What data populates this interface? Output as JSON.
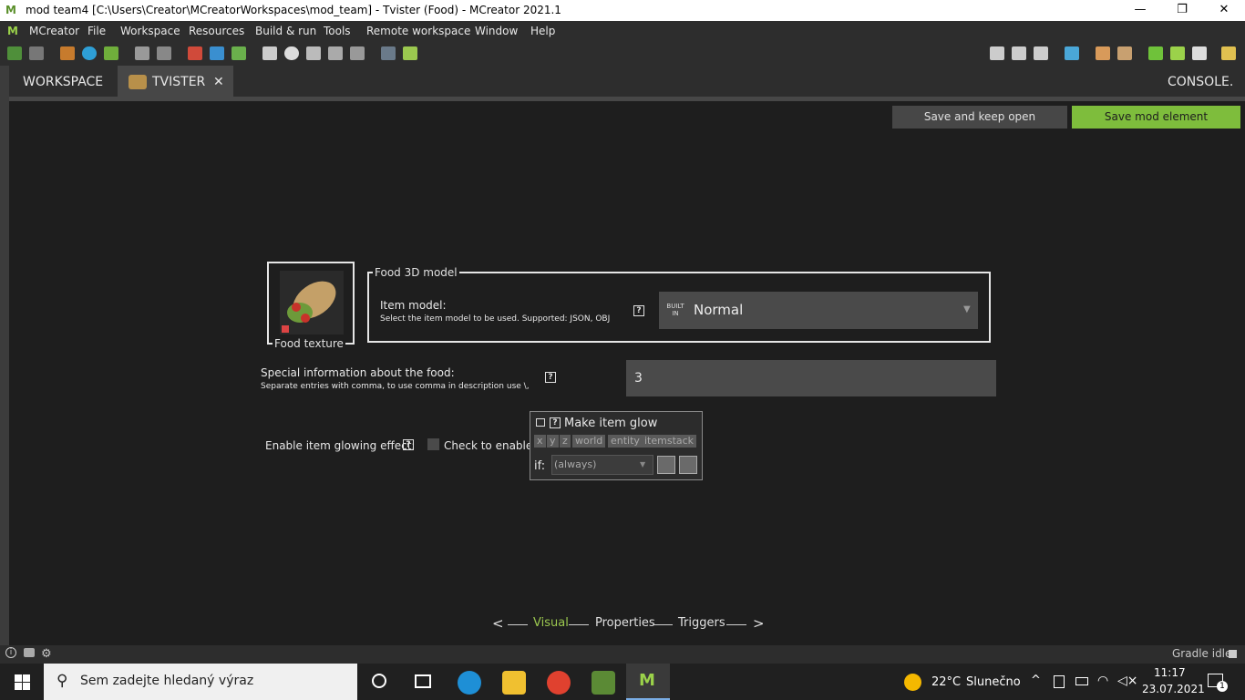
{
  "window": {
    "title": "mod team4 [C:\\Users\\Creator\\MCreatorWorkspaces\\mod_team] - Tvister (Food) - MCreator 2021.1",
    "minimize": "—",
    "restore": "❐",
    "close": "✕"
  },
  "menu": {
    "items": [
      "MCreator",
      "File",
      "Workspace",
      "Resources",
      "Build & run",
      "Tools",
      "Remote workspace",
      "Window",
      "Help"
    ]
  },
  "tabs": {
    "workspace": "WORKSPACE",
    "tvister": "TVISTER",
    "close": "✕",
    "console": "CONSOLE."
  },
  "actions": {
    "save_keep_open": "Save and keep open",
    "save_mod_element": "Save mod element"
  },
  "form": {
    "food_texture_label": "Food texture",
    "model_legend": "Food 3D model",
    "item_model_label": "Item model:",
    "item_model_hint": "Select the item model to be used. Supported: JSON, OBJ",
    "model_builtin_badge": "BUILT IN",
    "model_value": "Normal",
    "special_info_label": "Special information about the food:",
    "special_info_hint": "Separate entries with comma, to use comma in description use \\,",
    "special_info_value": "3",
    "glow_label": "Enable item glowing effect:",
    "glow_checkbox": "Check to enable",
    "procedure_title": "Make item glow",
    "procedure_deps": [
      "x",
      "y",
      "z",
      "world",
      "entity",
      "itemstack"
    ],
    "procedure_if": "if:",
    "procedure_condition": "(always)"
  },
  "pagenav": {
    "prev": "<",
    "visual": "Visual",
    "properties": "Properties",
    "triggers": "Triggers",
    "next": ">"
  },
  "status": {
    "gradle": "Gradle idle"
  },
  "taskbar": {
    "search_placeholder": "Sem zadejte hledaný výraz",
    "weather_temp": "22°C",
    "weather_text": "Slunečno",
    "time": "11:17",
    "date": "23.07.2021",
    "notifications": "1"
  },
  "colors": {
    "accent_green": "#7ebd3c",
    "visual_active": "#9bc84f"
  }
}
